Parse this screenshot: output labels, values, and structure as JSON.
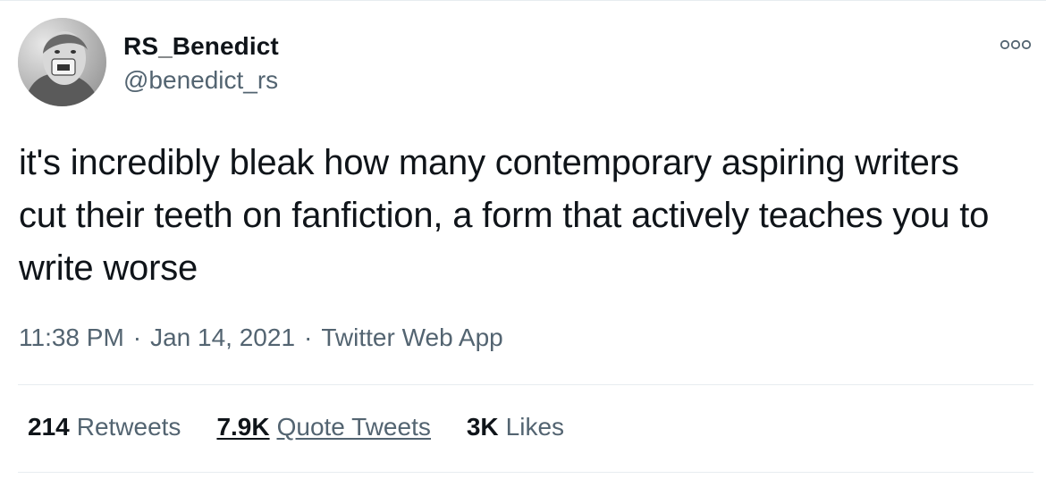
{
  "author": {
    "display_name": "RS_Benedict",
    "handle": "@benedict_rs"
  },
  "tweet": {
    "text": "it's incredibly bleak how many contemporary aspiring writers cut their teeth on fanfiction, a form that actively teaches you to write worse",
    "time": "11:38 PM",
    "date": "Jan 14, 2021",
    "source": "Twitter Web App",
    "separator": "·"
  },
  "stats": {
    "retweets_count": "214",
    "retweets_label": "Retweets",
    "quotes_count": "7.9K",
    "quotes_label": "Quote Tweets",
    "likes_count": "3K",
    "likes_label": "Likes"
  },
  "icons": {
    "more": "more-options-icon"
  },
  "colors": {
    "text_primary": "#0f1419",
    "text_secondary": "#536471",
    "divider": "#e7ecf0"
  }
}
